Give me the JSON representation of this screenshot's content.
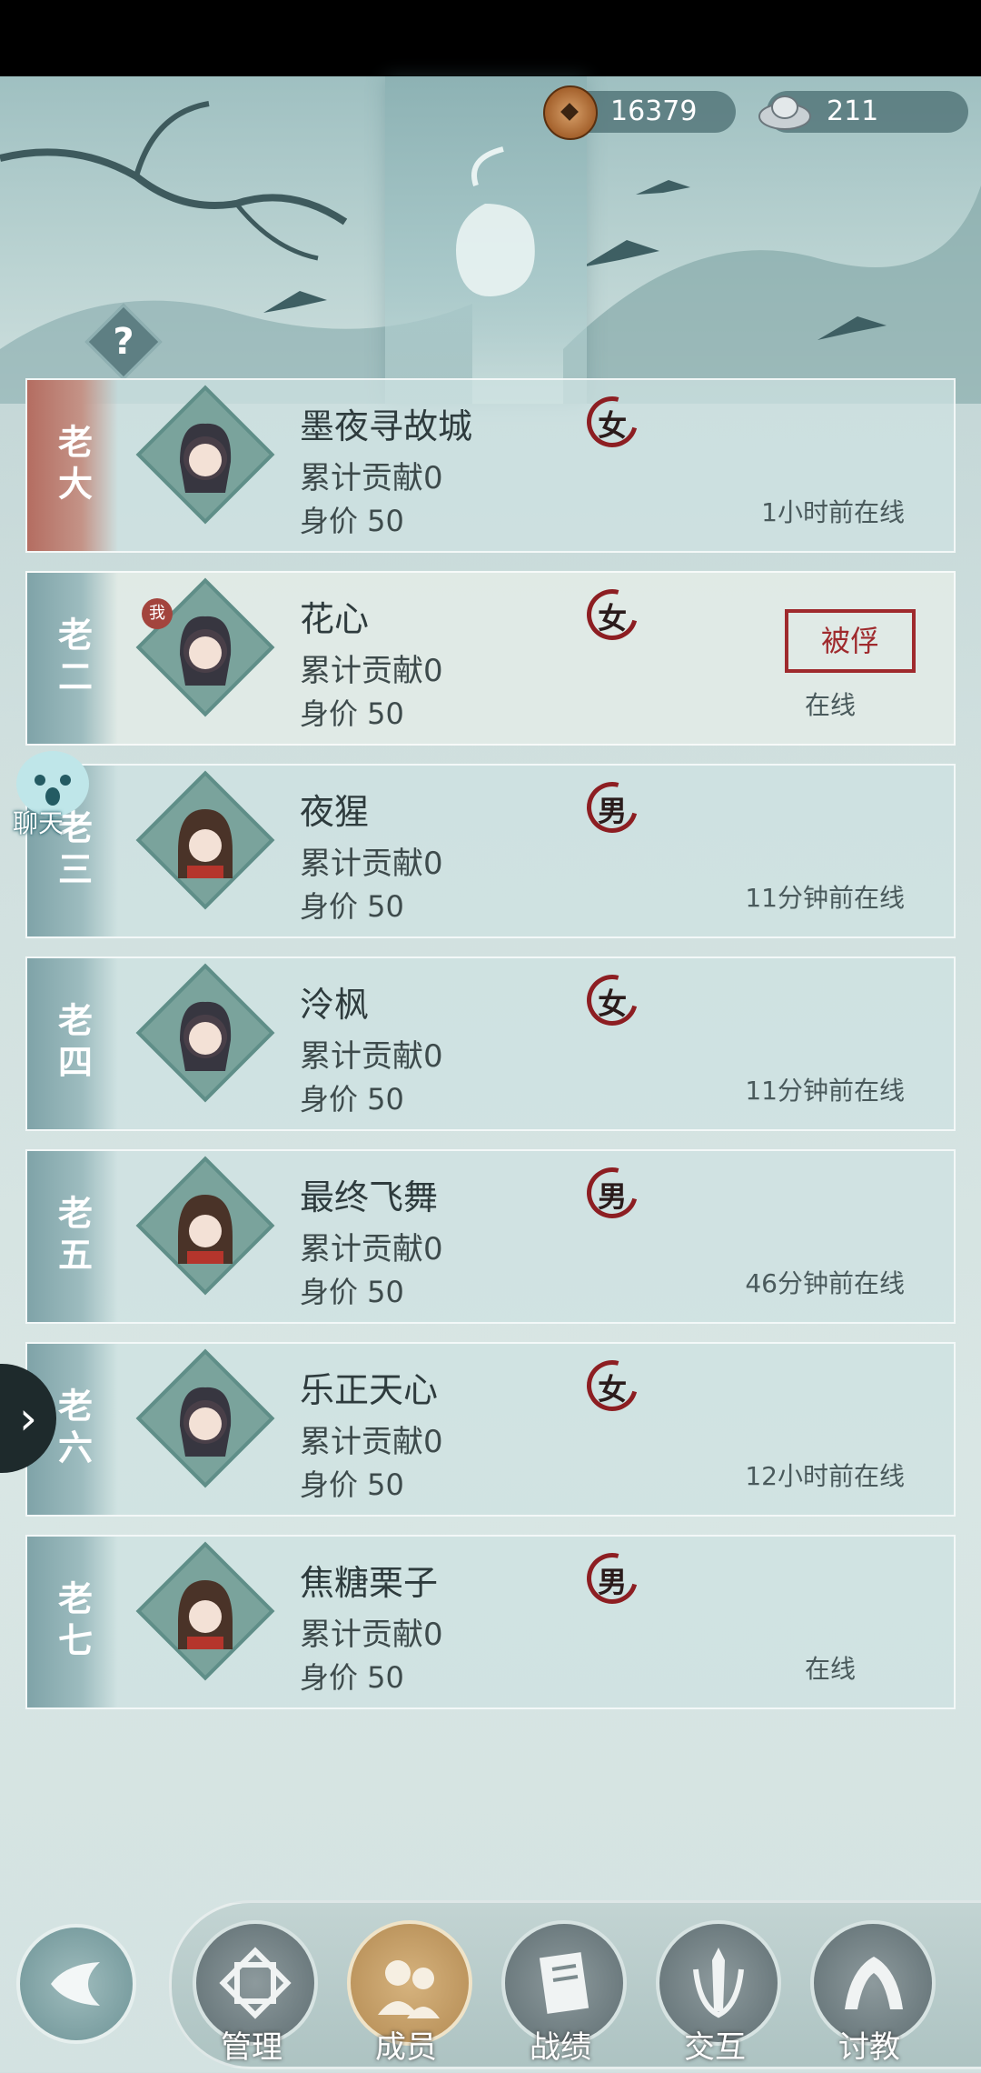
{
  "currency": {
    "coins": "16379",
    "silver": "211"
  },
  "help_label": "?",
  "members": [
    {
      "rank": "老大",
      "name": "墨夜寻故城",
      "contribution": "累计贡献0",
      "price": "身价 50",
      "gender": "女",
      "status": "1小时前在线"
    },
    {
      "rank": "老二",
      "name": "花心",
      "contribution": "累计贡献0",
      "price": "身价 50",
      "gender": "女",
      "status": "在线",
      "me_badge": "我",
      "captive": "被俘"
    },
    {
      "rank": "老三",
      "name": "夜猩",
      "contribution": "累计贡献0",
      "price": "身价 50",
      "gender": "男",
      "status": "11分钟前在线"
    },
    {
      "rank": "老四",
      "name": "泠枫",
      "contribution": "累计贡献0",
      "price": "身价 50",
      "gender": "女",
      "status": "11分钟前在线"
    },
    {
      "rank": "老五",
      "name": "最终飞舞",
      "contribution": "累计贡献0",
      "price": "身价 50",
      "gender": "男",
      "status": "46分钟前在线"
    },
    {
      "rank": "老六",
      "name": "乐正天心",
      "contribution": "累计贡献0",
      "price": "身价 50",
      "gender": "女",
      "status": "12小时前在线"
    },
    {
      "rank": "老七",
      "name": "焦糖栗子",
      "contribution": "累计贡献0",
      "price": "身价 50",
      "gender": "男",
      "status": "在线"
    }
  ],
  "chat_label": "聊天",
  "nav": [
    {
      "label": "管理"
    },
    {
      "label": "成员"
    },
    {
      "label": "战绩"
    },
    {
      "label": "交互"
    },
    {
      "label": "讨教"
    }
  ]
}
